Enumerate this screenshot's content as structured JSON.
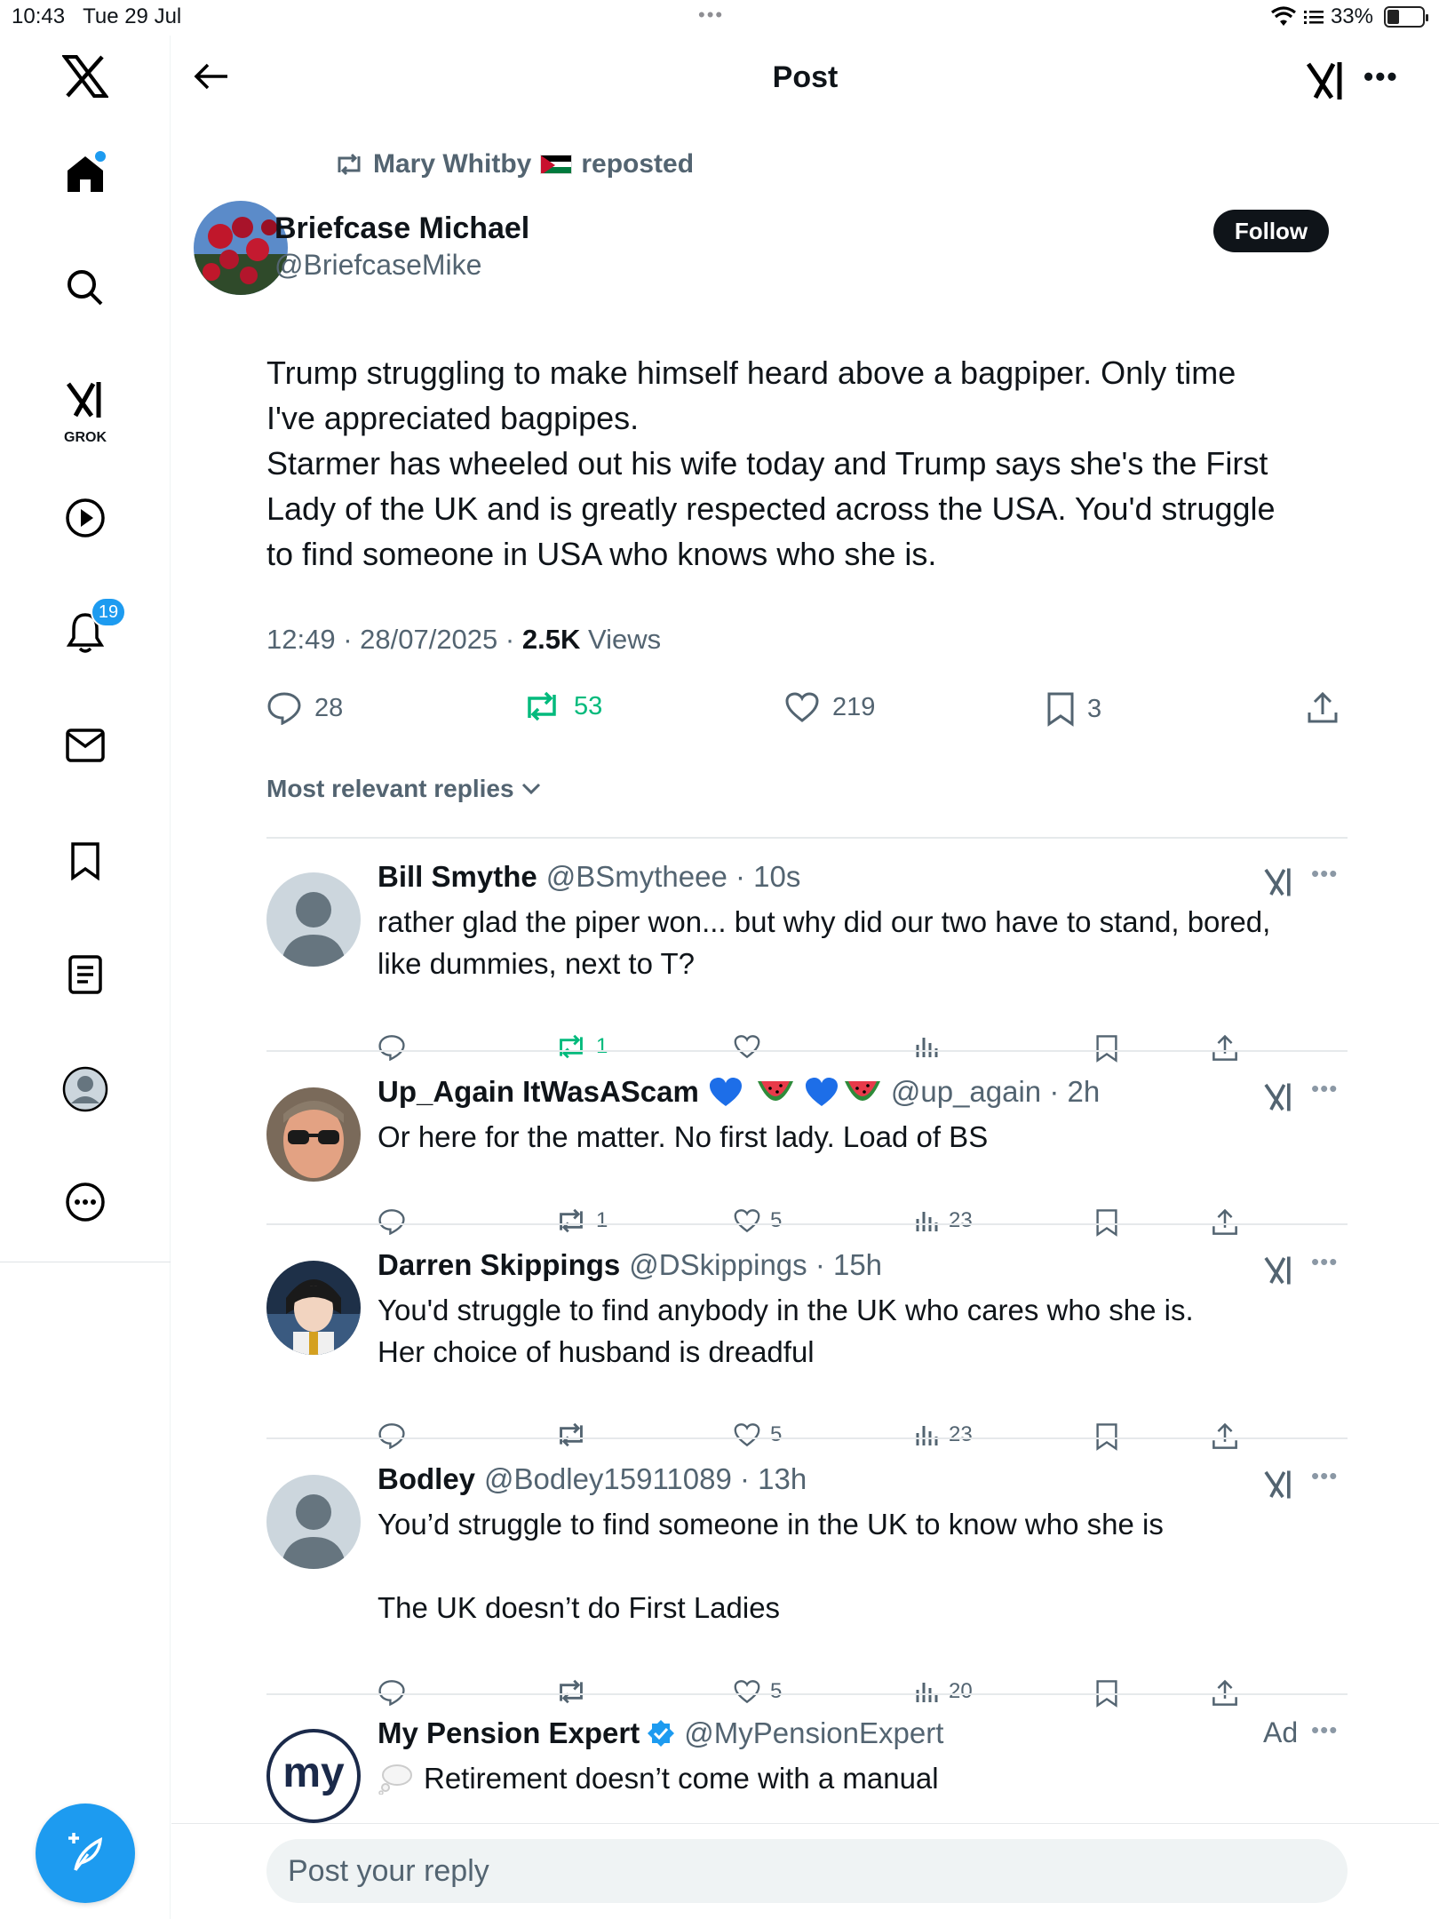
{
  "status": {
    "time": "10:43",
    "date": "Tue 29 Jul",
    "battery": "33%",
    "battery_level": 0.33
  },
  "sidebar": {
    "notifications_badge": "19",
    "grok_label": "GROK"
  },
  "header": {
    "title": "Post"
  },
  "post": {
    "repost_by": "Mary Whitby",
    "repost_suffix": "reposted",
    "author_name": "Briefcase Michael",
    "author_handle": "@BriefcaseMike",
    "follow_label": "Follow",
    "text": "Trump struggling to make himself heard above a bagpiper. Only time\nI've appreciated bagpipes.\nStarmer has wheeled out his wife today and Trump says she's the First\nLady of the UK and is greatly respected across the USA. You'd struggle\nto find someone in USA who knows who she is.",
    "timestamp": "12:49 · 28/07/2025 ·",
    "views_count": "2.5K",
    "views_label": "Views",
    "replies": "28",
    "reposts": "53",
    "likes": "219",
    "bookmarks": "3"
  },
  "sort_label": "Most relevant replies",
  "replies": [
    {
      "name": "Bill Smythe",
      "handle": "@BSmytheee · 10s",
      "text": "rather glad the piper won... but why did our two have to stand, bored,\nlike dummies, next to T?",
      "reposts": "1",
      "likes": "",
      "views": ""
    },
    {
      "name": "Up_Again ItWasAScam",
      "handle": "@up_again · 2h",
      "text": "Or here for the matter. No first lady. Load of BS",
      "reposts": "1",
      "likes": "5",
      "views": "23"
    },
    {
      "name": "Darren Skippings",
      "handle": "@DSkippings · 15h",
      "text": "You'd struggle to find anybody in the UK who cares who she is.\nHer choice of husband is dreadful",
      "reposts": "",
      "likes": "5",
      "views": "23"
    },
    {
      "name": "Bodley",
      "handle": "@Bodley15911089 · 13h",
      "text": "You’d struggle to find someone in the UK to know who she is\n\nThe UK doesn’t do First Ladies",
      "reposts": "",
      "likes": "5",
      "views": "20"
    }
  ],
  "ad": {
    "name": "My Pension Expert",
    "handle": "@MyPensionExpert",
    "label": "Ad",
    "text": "Retirement doesn’t come with a manual",
    "logo_text": "my"
  },
  "reply_box": {
    "placeholder": "Post your reply"
  },
  "colors": {
    "accent": "#1d9bf0",
    "repost_green": "#00ba7c",
    "text_secondary": "#536471"
  }
}
